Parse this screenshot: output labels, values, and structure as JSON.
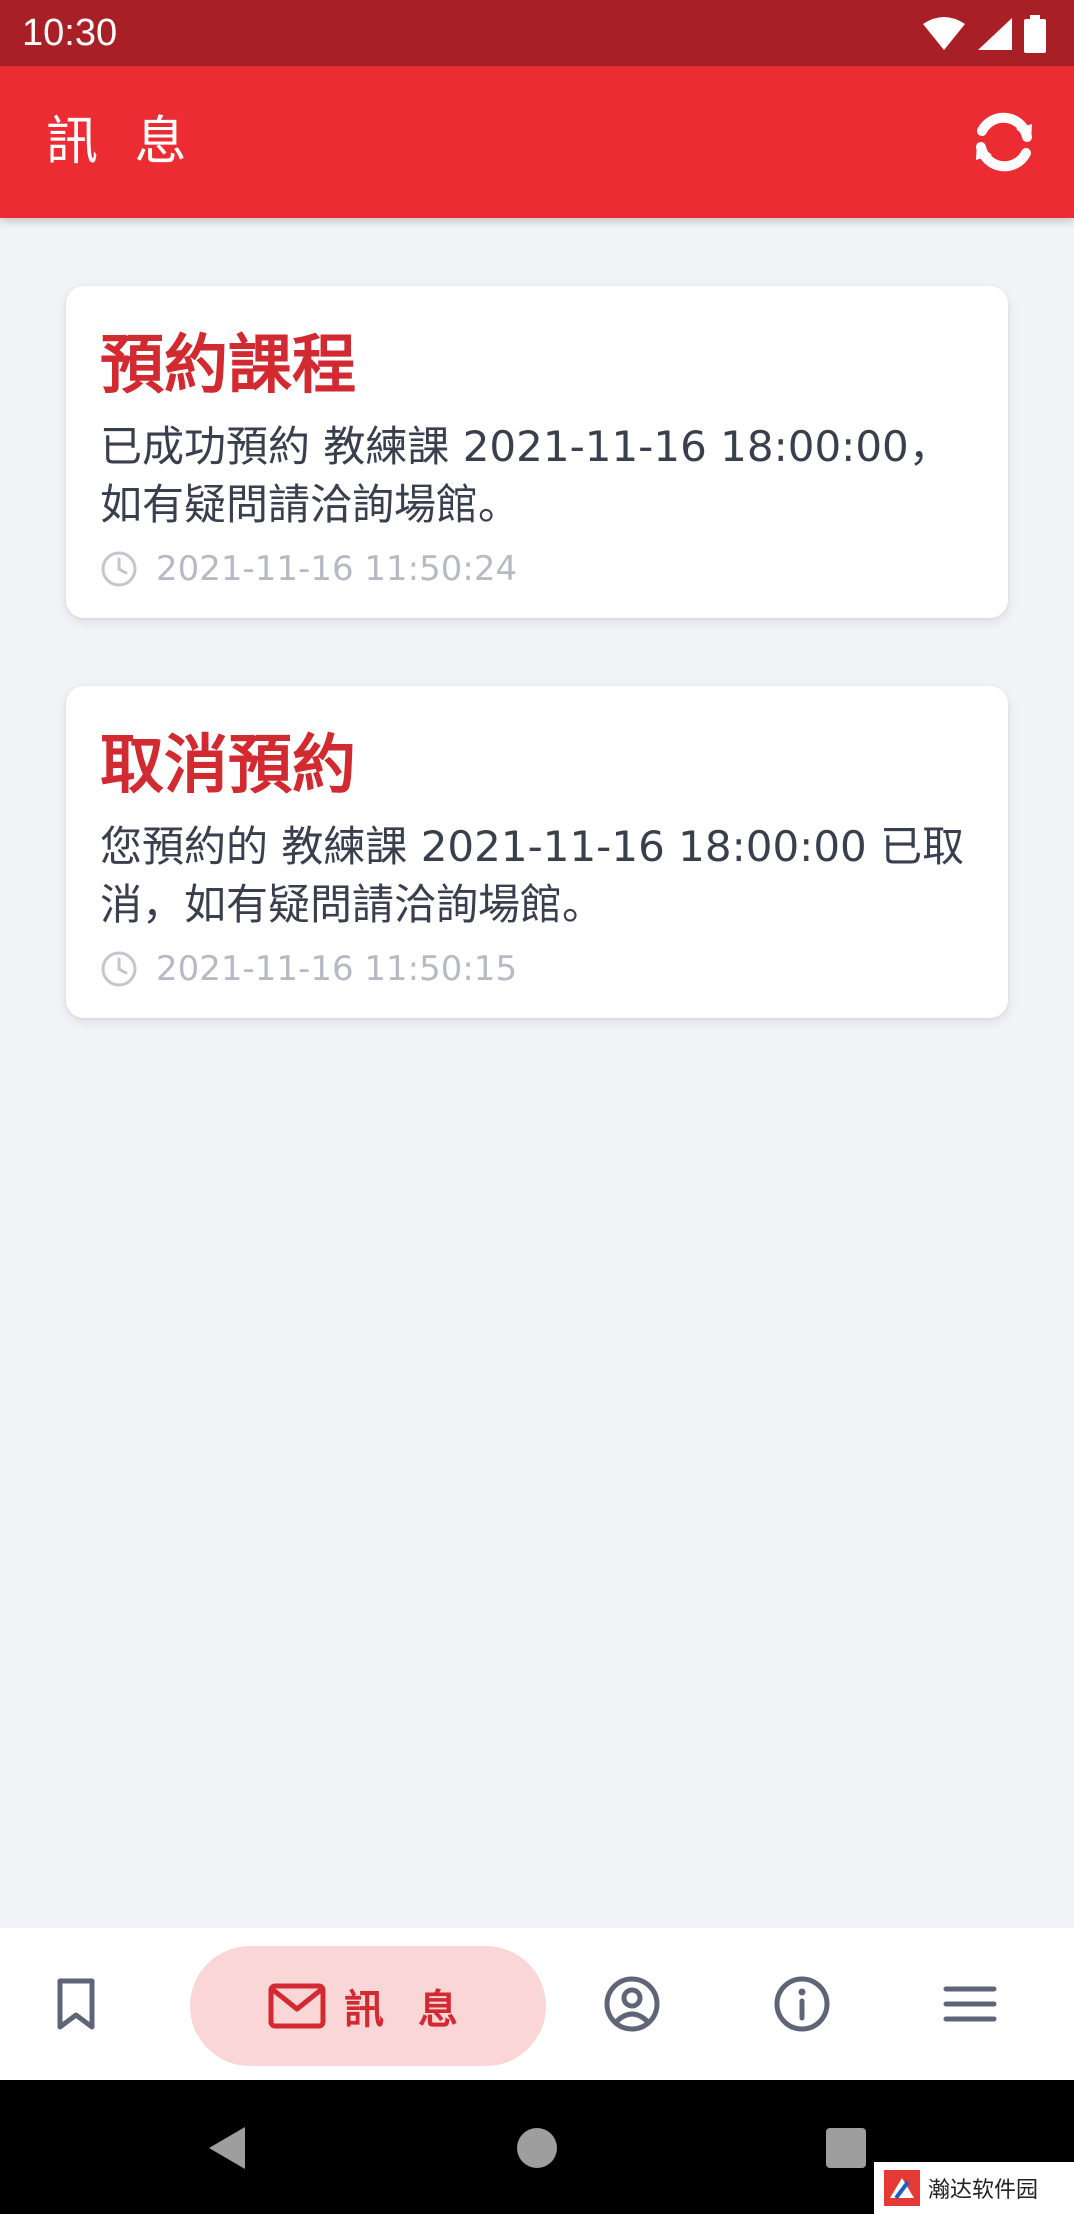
{
  "status_bar": {
    "time": "10:30",
    "icons": [
      "wifi-icon",
      "signal-icon",
      "battery-icon"
    ]
  },
  "app_bar": {
    "title": "訊 息",
    "refresh_icon": "refresh-icon"
  },
  "messages": [
    {
      "title": "預約課程",
      "body": "已成功預約 教練課 2021-11-16 18:00:00，如有疑問請洽詢場館。",
      "time": "2021-11-16 11:50:24"
    },
    {
      "title": "取消預約",
      "body": "您預約的 教練課 2021-11-16 18:00:00 已取消，如有疑問請洽詢場館。",
      "time": "2021-11-16 11:50:15"
    }
  ],
  "bottom_nav": {
    "items": [
      {
        "icon": "bookmark-icon",
        "label": ""
      },
      {
        "icon": "mail-icon",
        "label": "訊 息",
        "active": true
      },
      {
        "icon": "account-icon",
        "label": ""
      },
      {
        "icon": "info-icon",
        "label": ""
      },
      {
        "icon": "menu-icon",
        "label": ""
      }
    ]
  },
  "system_nav": [
    "back-icon",
    "home-icon",
    "recents-icon"
  ],
  "watermark": {
    "text": "瀚达软件园"
  },
  "colors": {
    "status_bar": "#a91f26",
    "app_bar": "#ec2c33",
    "accent": "#d12a31",
    "active_nav_bg": "#fad6d7",
    "background": "#f3f4f8",
    "icon_gray": "#5f6577"
  }
}
